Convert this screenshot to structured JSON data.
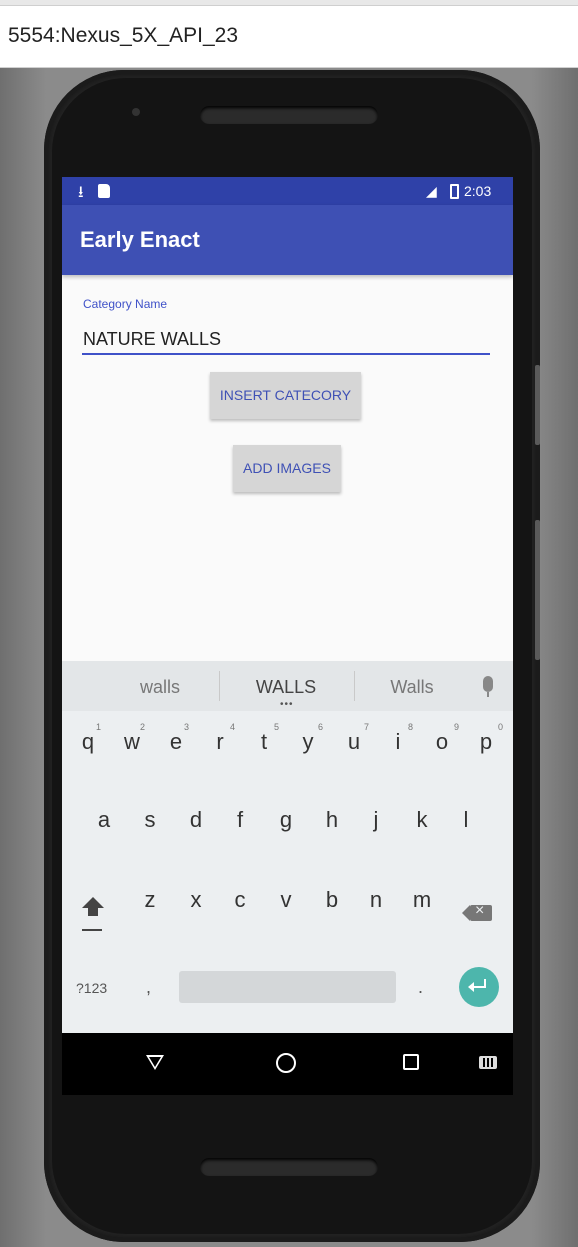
{
  "window": {
    "title": "5554:Nexus_5X_API_23"
  },
  "status_bar": {
    "time": "2:03"
  },
  "app_bar": {
    "title": "Early Enact"
  },
  "form": {
    "category_label": "Category Name",
    "category_value": "NATURE WALLS",
    "insert_button": "INSERT CATECORY",
    "add_images_button": "ADD IMAGES"
  },
  "keyboard": {
    "suggestions": [
      "walls",
      "WALLS",
      "Walls"
    ],
    "more_indicator": "•••",
    "row1": [
      {
        "key": "q",
        "hint": "1"
      },
      {
        "key": "w",
        "hint": "2"
      },
      {
        "key": "e",
        "hint": "3"
      },
      {
        "key": "r",
        "hint": "4"
      },
      {
        "key": "t",
        "hint": "5"
      },
      {
        "key": "y",
        "hint": "6"
      },
      {
        "key": "u",
        "hint": "7"
      },
      {
        "key": "i",
        "hint": "8"
      },
      {
        "key": "o",
        "hint": "9"
      },
      {
        "key": "p",
        "hint": "0"
      }
    ],
    "row2": [
      "a",
      "s",
      "d",
      "f",
      "g",
      "h",
      "j",
      "k",
      "l"
    ],
    "row3": [
      "z",
      "x",
      "c",
      "v",
      "b",
      "n",
      "m"
    ],
    "symbols_key": "?123",
    "comma_key": ",",
    "period_key": ".",
    "accent_color": "#4db6ac"
  },
  "colors": {
    "primary": "#3e50b4",
    "primary_dark": "#2f41a8",
    "accent_text": "#3f51c8"
  },
  "icons": [
    "download-icon",
    "sd-card-icon",
    "signal-icon",
    "battery-icon",
    "mic-icon",
    "shift-icon",
    "backspace-icon",
    "enter-icon",
    "back-icon",
    "home-icon",
    "recents-icon",
    "keyboard-icon"
  ]
}
